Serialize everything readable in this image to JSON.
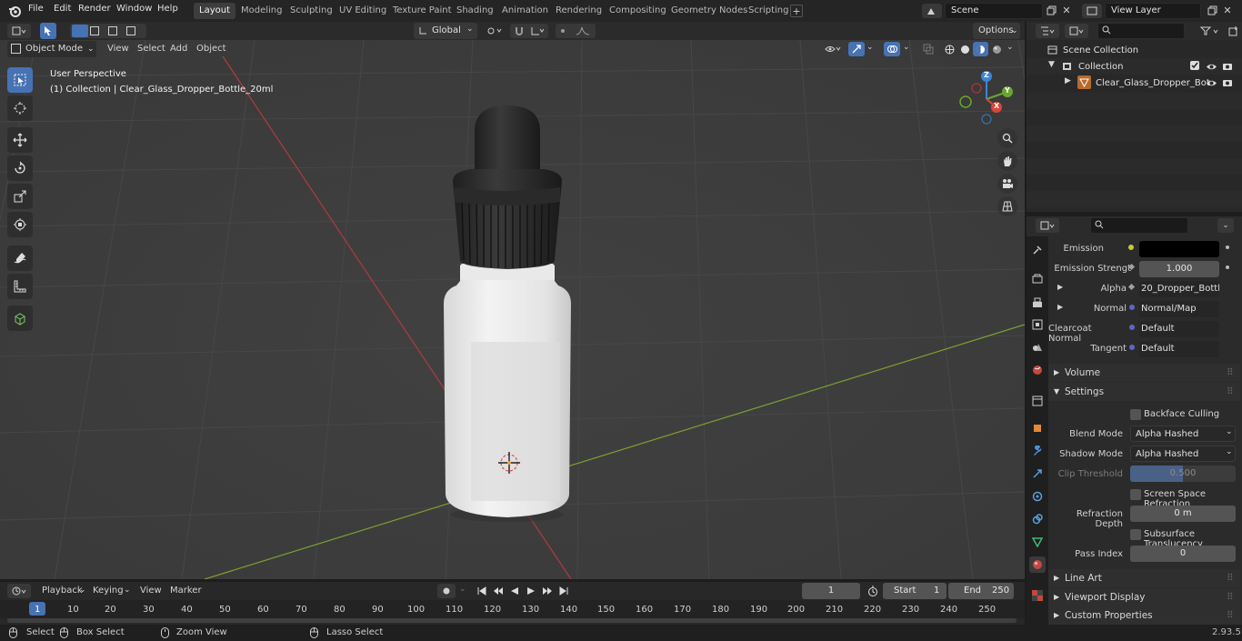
{
  "topbar": {
    "menus": [
      "File",
      "Edit",
      "Render",
      "Window",
      "Help"
    ],
    "workspaces": [
      "Layout",
      "Modeling",
      "Sculpting",
      "UV Editing",
      "Texture Paint",
      "Shading",
      "Animation",
      "Rendering",
      "Compositing",
      "Geometry Nodes",
      "Scripting"
    ],
    "active_workspace": "Layout",
    "scene_name": "Scene",
    "view_layer": "View Layer"
  },
  "viewport_header": {
    "mode": "Object Mode",
    "menus": [
      "View",
      "Select",
      "Add",
      "Object"
    ],
    "orientation": "Global",
    "options_label": "Options"
  },
  "viewport": {
    "perspective_label": "User Perspective",
    "collection_label": "(1) Collection | Clear_Glass_Dropper_Bottle_20ml",
    "gizmo_axes": [
      "Z",
      "Y",
      "X"
    ]
  },
  "outliner": {
    "scene_collection": "Scene Collection",
    "collection": "Collection",
    "object": "Clear_Glass_Dropper_Bot"
  },
  "properties": {
    "rows": [
      {
        "label": "Emission",
        "value": ""
      },
      {
        "label": "Emission Strengt",
        "value": "1.000"
      },
      {
        "label": "Alpha",
        "value": "20_Dropper_Bottle_l..."
      },
      {
        "label": "Normal",
        "value": "Normal/Map"
      },
      {
        "label": "Clearcoat Normal",
        "value": "Default"
      },
      {
        "label": "Tangent",
        "value": "Default"
      }
    ],
    "sections": {
      "volume": "Volume",
      "settings": "Settings",
      "line_art": "Line Art",
      "viewport_display": "Viewport Display",
      "custom_properties": "Custom Properties"
    },
    "settings": {
      "backface_culling": "Backface Culling",
      "blend_mode_label": "Blend Mode",
      "blend_mode": "Alpha Hashed",
      "shadow_mode_label": "Shadow Mode",
      "shadow_mode": "Alpha Hashed",
      "clip_threshold_label": "Clip Threshold",
      "clip_threshold": "0.500",
      "screen_space_refraction": "Screen Space Refraction",
      "refraction_depth_label": "Refraction Depth",
      "refraction_depth": "0 m",
      "subsurface_translucency": "Subsurface Translucency",
      "pass_index_label": "Pass Index",
      "pass_index": "0"
    }
  },
  "timeline": {
    "menus": [
      "Playback",
      "Keying",
      "View",
      "Marker"
    ],
    "current_frame": "1",
    "start_label": "Start",
    "start": "1",
    "end_label": "End",
    "end": "250",
    "ticks": [
      "1",
      "10",
      "20",
      "30",
      "40",
      "50",
      "60",
      "70",
      "80",
      "90",
      "100",
      "110",
      "120",
      "130",
      "140",
      "150",
      "160",
      "170",
      "180",
      "190",
      "200",
      "210",
      "220",
      "230",
      "240",
      "250"
    ]
  },
  "statusbar": {
    "select": "Select",
    "box_select": "Box Select",
    "zoom_view": "Zoom View",
    "lasso_select": "Lasso Select",
    "version": "2.93.5"
  }
}
